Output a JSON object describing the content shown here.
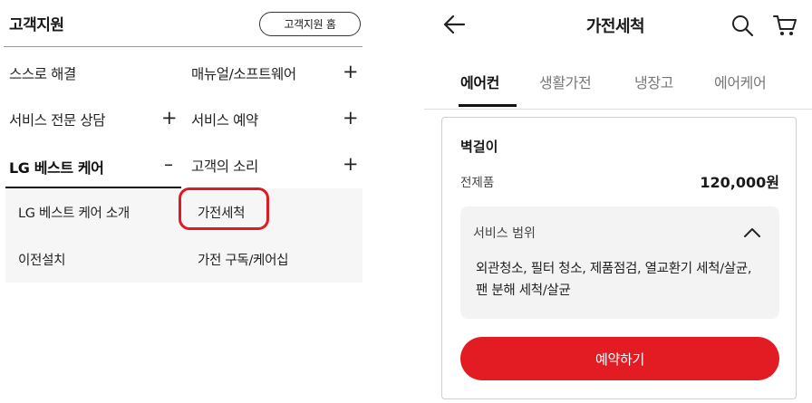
{
  "left_panel": {
    "title": "고객지원",
    "home_button": "고객지원 홈",
    "menu": {
      "self_solve": "스스로 해결",
      "manual_software": "매뉴얼/소프트웨어",
      "expert_consult": "서비스 전문 상담",
      "service_reservation": "서비스 예약",
      "lg_best_care": "LG 베스트 케어",
      "customer_voice": "고객의 소리",
      "plus_sign": "+",
      "minus_sign": "–"
    },
    "submenu": {
      "best_care_intro": "LG 베스트 케어 소개",
      "appliance_cleaning": "가전세척",
      "relocation_install": "이전설치",
      "subscription_care": "가전 구독/케어십"
    },
    "colors": {
      "highlight": "#e01a22"
    }
  },
  "right_panel": {
    "header": {
      "title": "가전세척",
      "icons": [
        "back-arrow-icon",
        "search-icon",
        "cart-icon"
      ]
    },
    "tabs": [
      {
        "label": "에어컨",
        "active": true
      },
      {
        "label": "생활가전",
        "active": false
      },
      {
        "label": "냉장고",
        "active": false
      },
      {
        "label": "에어케어",
        "active": false
      }
    ],
    "product": {
      "name": "벽걸이",
      "label": "전제품",
      "price": "120,000원"
    },
    "service_scope": {
      "title": "서비스 범위",
      "expanded": true,
      "description": "외관청소, 필터 청소, 제품점검, 열교환기 세척/살균, 팬 분해 세척/살균"
    },
    "reserve_button": "예약하기",
    "colors": {
      "accent": "#e31b23"
    }
  }
}
